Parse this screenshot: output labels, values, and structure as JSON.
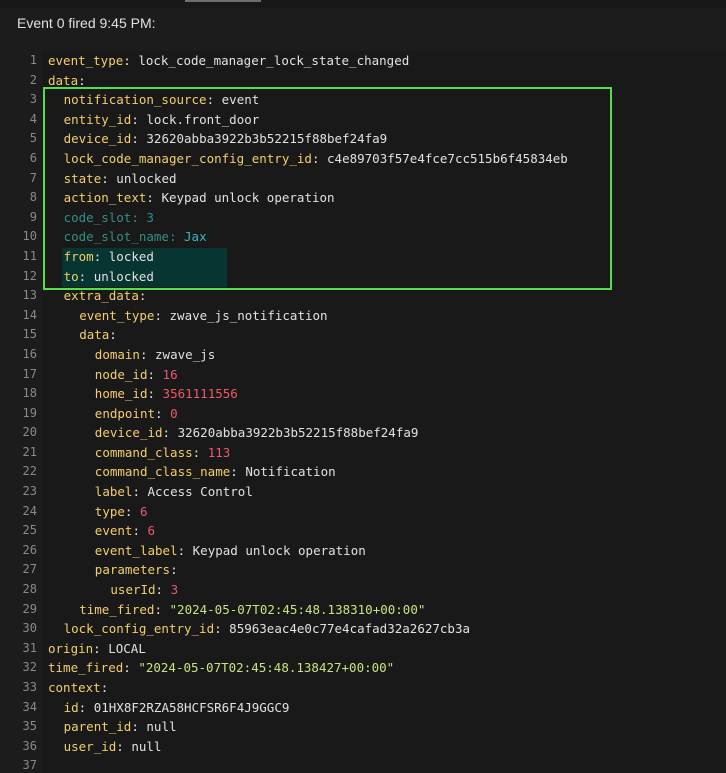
{
  "header": {
    "title": "Event 0 fired 9:45 PM:"
  },
  "lines": [
    {
      "n": "1",
      "indent": 0,
      "key": "event_type",
      "value": "lock_code_manager_lock_state_changed",
      "vtype": "v"
    },
    {
      "n": "2",
      "indent": 0,
      "key": "data",
      "value": "",
      "vtype": "v"
    },
    {
      "n": "3",
      "indent": 1,
      "key": "notification_source",
      "value": "event",
      "vtype": "v"
    },
    {
      "n": "4",
      "indent": 1,
      "key": "entity_id",
      "value": "lock.front_door",
      "vtype": "v"
    },
    {
      "n": "5",
      "indent": 1,
      "key": "device_id",
      "value": "32620abba3922b3b52215f88bef24fa9",
      "vtype": "v"
    },
    {
      "n": "6",
      "indent": 1,
      "key": "lock_code_manager_config_entry_id",
      "value": "c4e89703f57e4fce7cc515b6f45834eb",
      "vtype": "v"
    },
    {
      "n": "7",
      "indent": 1,
      "key": "state",
      "value": "unlocked",
      "vtype": "v"
    },
    {
      "n": "8",
      "indent": 1,
      "key": "action_text",
      "value": "Keypad unlock operation",
      "vtype": "v"
    },
    {
      "n": "9",
      "indent": 1,
      "key": "code_slot",
      "value": "3",
      "vtype": "sel-n",
      "selected": true
    },
    {
      "n": "10",
      "indent": 1,
      "key": "code_slot_name",
      "value": "Jax",
      "vtype": "sel-vj",
      "selected": true
    },
    {
      "n": "11",
      "indent": 1,
      "key": "from",
      "value": "locked",
      "vtype": "v"
    },
    {
      "n": "12",
      "indent": 1,
      "key": "to",
      "value": "unlocked",
      "vtype": "v"
    },
    {
      "n": "13",
      "indent": 1,
      "key": "extra_data",
      "value": "",
      "vtype": "v"
    },
    {
      "n": "14",
      "indent": 2,
      "key": "event_type",
      "value": "zwave_js_notification",
      "vtype": "v"
    },
    {
      "n": "15",
      "indent": 2,
      "key": "data",
      "value": "",
      "vtype": "v"
    },
    {
      "n": "16",
      "indent": 3,
      "key": "domain",
      "value": "zwave_js",
      "vtype": "v"
    },
    {
      "n": "17",
      "indent": 3,
      "key": "node_id",
      "value": "16",
      "vtype": "n"
    },
    {
      "n": "18",
      "indent": 3,
      "key": "home_id",
      "value": "3561111556",
      "vtype": "n"
    },
    {
      "n": "19",
      "indent": 3,
      "key": "endpoint",
      "value": "0",
      "vtype": "n"
    },
    {
      "n": "20",
      "indent": 3,
      "key": "device_id",
      "value": "32620abba3922b3b52215f88bef24fa9",
      "vtype": "v"
    },
    {
      "n": "21",
      "indent": 3,
      "key": "command_class",
      "value": "113",
      "vtype": "n"
    },
    {
      "n": "22",
      "indent": 3,
      "key": "command_class_name",
      "value": "Notification",
      "vtype": "v"
    },
    {
      "n": "23",
      "indent": 3,
      "key": "label",
      "value": "Access Control",
      "vtype": "v"
    },
    {
      "n": "24",
      "indent": 3,
      "key": "type",
      "value": "6",
      "vtype": "n"
    },
    {
      "n": "25",
      "indent": 3,
      "key": "event",
      "value": "6",
      "vtype": "n"
    },
    {
      "n": "26",
      "indent": 3,
      "key": "event_label",
      "value": "Keypad unlock operation",
      "vtype": "v"
    },
    {
      "n": "27",
      "indent": 3,
      "key": "parameters",
      "value": "",
      "vtype": "v"
    },
    {
      "n": "28",
      "indent": 4,
      "key": "userId",
      "value": "3",
      "vtype": "n"
    },
    {
      "n": "29",
      "indent": 2,
      "key": "time_fired",
      "value": "\"2024-05-07T02:45:48.138310+00:00\"",
      "vtype": "s"
    },
    {
      "n": "30",
      "indent": 1,
      "key": "lock_config_entry_id",
      "value": "85963eac4e0c77e4cafad32a2627cb3a",
      "vtype": "v"
    },
    {
      "n": "31",
      "indent": 0,
      "key": "origin",
      "value": "LOCAL",
      "vtype": "v"
    },
    {
      "n": "32",
      "indent": 0,
      "key": "time_fired",
      "value": "\"2024-05-07T02:45:48.138427+00:00\"",
      "vtype": "s"
    },
    {
      "n": "33",
      "indent": 0,
      "key": "context",
      "value": "",
      "vtype": "v"
    },
    {
      "n": "34",
      "indent": 1,
      "key": "id",
      "value": "01HX8F2RZA58HCFSR6F4J9GGC9",
      "vtype": "v"
    },
    {
      "n": "35",
      "indent": 1,
      "key": "parent_id",
      "value": "null",
      "vtype": "v"
    },
    {
      "n": "36",
      "indent": 1,
      "key": "user_id",
      "value": "null",
      "vtype": "v"
    },
    {
      "n": "37",
      "indent": 0,
      "key": "",
      "value": "",
      "vtype": "v"
    }
  ],
  "colors": {
    "key": "#f3ce6a",
    "string": "#e1e1e1",
    "number": "#f0566f",
    "quoted": "#c5e67c",
    "highlight_box": "#52e04a",
    "selection": "#063532"
  }
}
